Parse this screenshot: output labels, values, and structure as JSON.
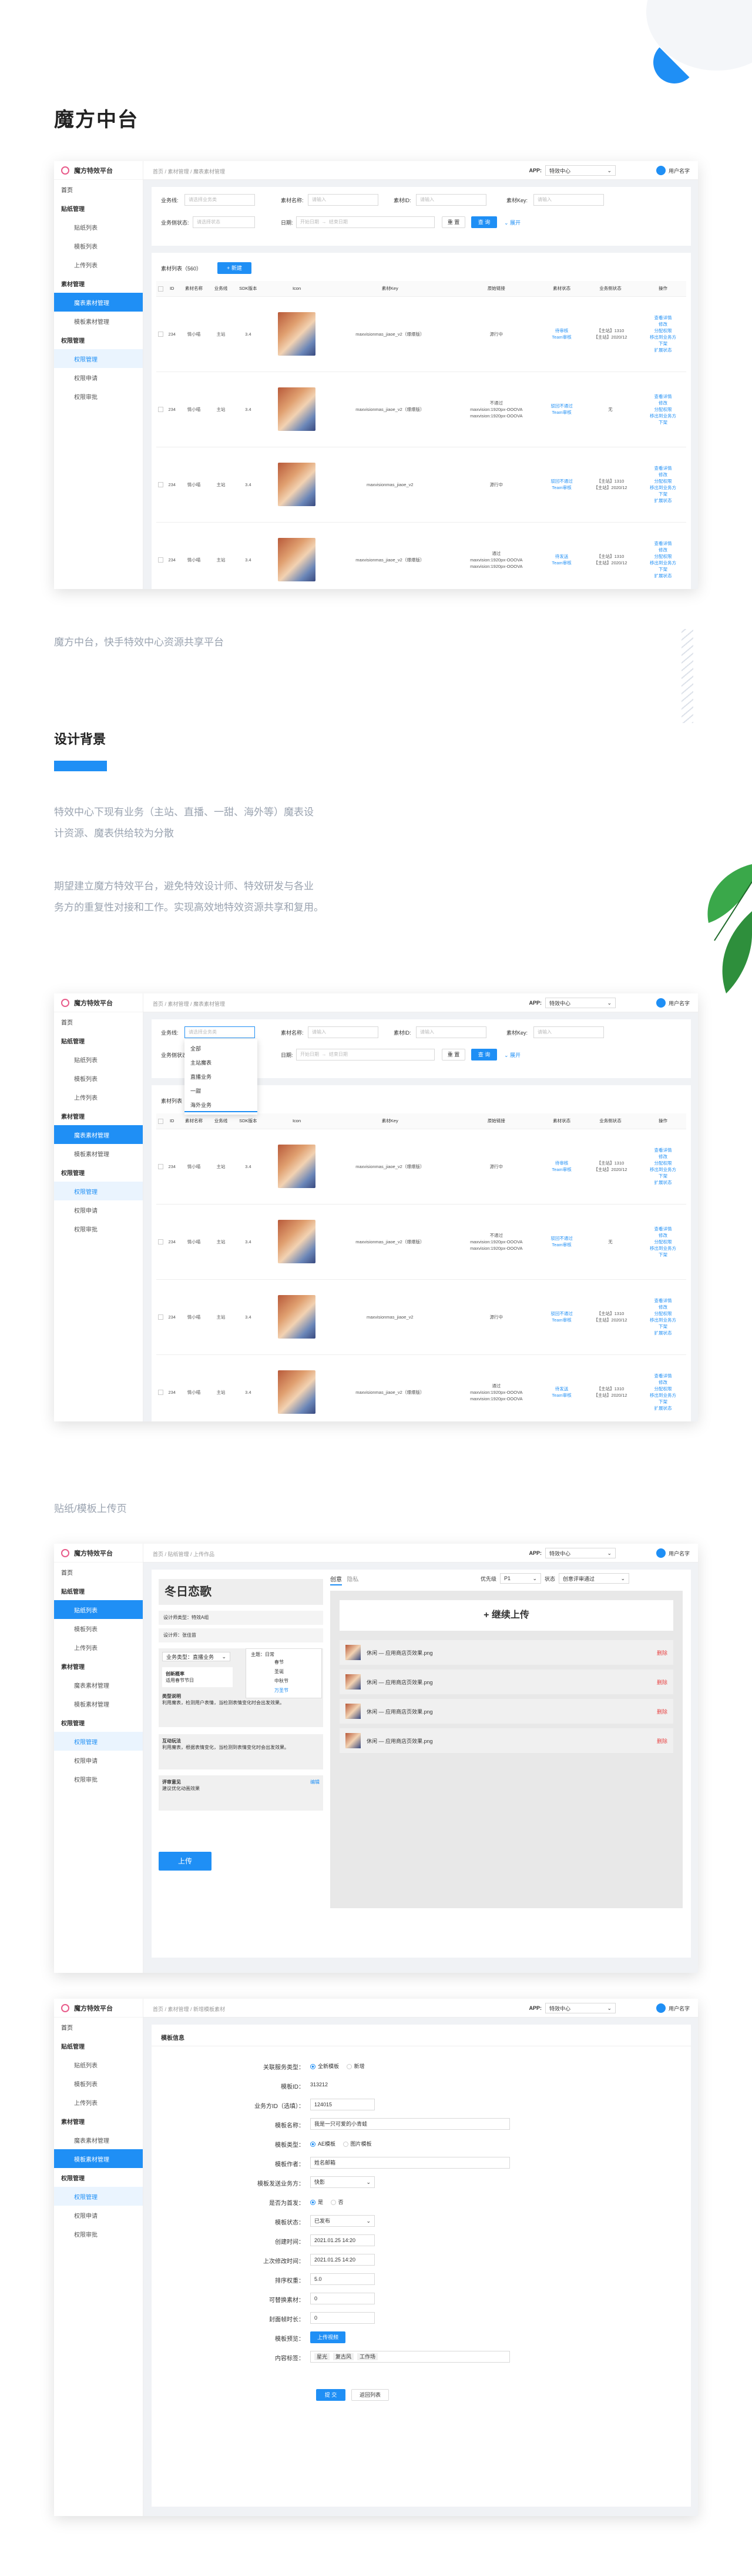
{
  "page": {
    "title": "魔方中台",
    "subtitle": "魔方中台，快手特效中心资源共享平台",
    "design_title": "设计背景",
    "design_p1a": "特效中心下现有业务（主站、直播、一甜、海外等）魔表设",
    "design_p1b": "计资源、魔表供给较为分散",
    "design_p2a": "期望建立魔方特效平台，避免特效设计师、特效研发与各业",
    "design_p2b": "务方的重复性对接和工作。实现高效地特效资源共享和复用。",
    "upload_caption": "贴纸/模板上传页"
  },
  "colors": {
    "primary": "#1f8ff5",
    "accent_blue": "#1f8ff5",
    "leaf": "#3aa84a"
  },
  "app": {
    "logo": "魔方特效平台",
    "app_label": "APP:",
    "app_value": "特效中心",
    "user": "用户名字"
  },
  "menu": {
    "home": "首页",
    "g1": "贴纸管理",
    "s1a": "贴纸列表",
    "s1b": "模板列表",
    "s1c": "上传列表",
    "g2": "素材管理",
    "s2a": "魔表素材管理",
    "s2b": "模板素材管理",
    "g3": "权限管理",
    "s3a": "权限管理",
    "s3b": "权限申请",
    "s3c": "权限审批"
  },
  "crumb1": "首页 / 素材管理 / 魔表素材管理",
  "crumb3": "首页 / 贴纸管理 / 上传作品",
  "crumb4": "首页 / 素材管理 / 新增模板素材",
  "filters": {
    "biz": "业务线:",
    "biz_ph": "请选择业务类",
    "name": "素材名称:",
    "name_ph": "请输入",
    "id": "素材ID:",
    "id_ph": "请输入",
    "key": "素材Key:",
    "key_ph": "请输入",
    "status": "业务侧状态:",
    "status_ph": "请选择状态",
    "date": "日期:",
    "date_start": "开始日期",
    "date_end": "结束日期",
    "reset": "重 置",
    "search": "查 询",
    "expand": "展开"
  },
  "list": {
    "title": "素材列表（560）",
    "new": "+ 新建",
    "headers": [
      "",
      "ID",
      "素材名称",
      "业务线",
      "SDK版本",
      "Icon",
      "素材Key",
      "原始链接",
      "素材状态",
      "业务侧状态",
      "操作"
    ]
  },
  "rows": [
    {
      "id": "234",
      "name": "情小喵",
      "biz": "主站",
      "sdk": "3.4",
      "key": "maxvisionmas_jiaoe_v2（爆爆版）",
      "links": "源行中",
      "status": "待审核\nTeam审核",
      "bstatus": "【主站】1310\n【主站】2020/12",
      "ops": "查看详情\n修改\n分配权限\n移出到业务方\n下架\n扩展状态"
    },
    {
      "id": "234",
      "name": "情小喵",
      "biz": "主站",
      "sdk": "3.4",
      "key": "maxvisionmas_jiaoe_v2（爆爆版）",
      "links": "不通过\nmaxvision:1920px-OOOVA\nmaxvision:1920px-OOOVA",
      "status": "驳回不通过\nTeam审核",
      "bstatus": "无",
      "ops": "查看详情\n修改\n分配权限\n移出到业务方\n下架"
    },
    {
      "id": "234",
      "name": "情小喵",
      "biz": "主站",
      "sdk": "3.4",
      "key": "maxvisionmas_jiaoe_v2",
      "links": "源行中",
      "status": "驳回不通过\nTeam审核",
      "bstatus": "【主站】1310\n【主站】2020/12",
      "ops": "查看详情\n修改\n分配权限\n移出到业务方\n下架\n扩展状态"
    },
    {
      "id": "234",
      "name": "情小喵",
      "biz": "主站",
      "sdk": "3.4",
      "key": "maxvisionmas_jiaoe_v2（爆爆版）",
      "links": "通过\nmaxvision:1920px-OOOVA\nmaxvision:1920px-OOOVA",
      "status": "待发送\nTeam审核",
      "bstatus": "【主站】1310\n【主站】2020/12",
      "ops": "查看详情\n修改\n分配权限\n移出到业务方\n下架\n扩展状态"
    }
  ],
  "dropdown": {
    "items": [
      "全部",
      "主站魔表",
      "直播业务",
      "一甜",
      "海外业务"
    ]
  },
  "upload": {
    "title": "冬日恋歌",
    "tab1": "创意",
    "tab2": "隐私",
    "priority": "优先级",
    "priority_val": "P1",
    "status": "状态",
    "status_val": "创意评审通过",
    "continue": "继续上传",
    "designer": "设计师类型：",
    "designer_val": "特效A组",
    "owner": "设计师：",
    "owner_val": "张佳苗",
    "biz": "业务类型：",
    "biz_val": "直播业务",
    "theme": "主题：",
    "theme_val": "日常",
    "opts": [
      "春节",
      "圣诞",
      "中秋节",
      "万圣节"
    ],
    "s1": "创新概率",
    "s1v": "适用春节节日",
    "s2": "类型说明",
    "s2v": "利用魔表，检测用户表情，当检测表情变化时会出发效果。",
    "s3": "互动玩法",
    "s3v": "利用魔表，根据表情变化，当检测到表情变化时会出发效果。",
    "s4": "评审意见",
    "s4v": "建议优化动画效果",
    "s4link": "编辑",
    "submit": "上传",
    "files": [
      "休闲 — 应用商店页效果.png",
      "休闲 — 应用商店页效果.png",
      "休闲 — 应用商店页效果.png",
      "休闲 — 应用商店页效果.png"
    ],
    "del": "删除"
  },
  "form": {
    "section": "模板信息",
    "f1": "关联服务类型：",
    "f1a": "全新模板",
    "f1b": "新增",
    "f2": "模板ID：",
    "f2v": "313212",
    "f3": "业务方ID（选填）：",
    "f3v": "124015",
    "f4": "模板名称：",
    "f4v": "我是一只可爱的小青蛙",
    "f5": "模板类型：",
    "f5a": "AE模板",
    "f5b": "图片模板",
    "f6": "模板作者：",
    "f6v": "姓名邮箱",
    "f7": "模板发送业务方：",
    "f7v": "快影",
    "f8": "是否为首发：",
    "f8a": "是",
    "f8b": "否",
    "f9": "模板状态：",
    "f9v": "已发布",
    "f10": "创建时间：",
    "f10v": "2021.01.25  14:20",
    "f11": "上次修改时间：",
    "f11v": "2021.01.25  14:20",
    "f12": "排序权重：",
    "f12v": "5.0",
    "f13": "可替换素材：",
    "f13v": "0",
    "f14": "封面帧时长：",
    "f14v": "0",
    "f15": "模板预览：",
    "f15v": "上传视频",
    "f16": "内容标签：",
    "tags": [
      "星光",
      "复古风",
      "工作场"
    ],
    "ok": "提 交",
    "back": "返回列表"
  }
}
